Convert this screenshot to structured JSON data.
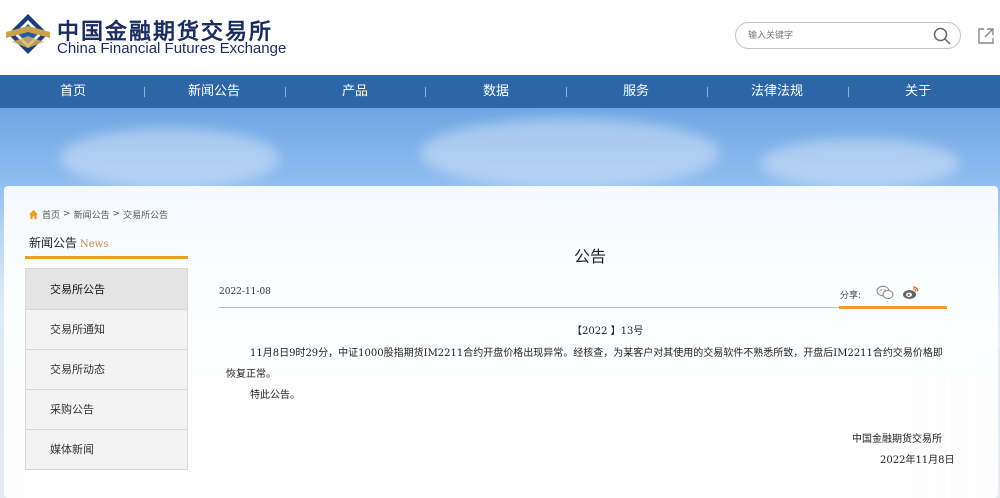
{
  "header": {
    "logo_cn": "中国金融期货交易所",
    "logo_en": "China Financial Futures Exchange",
    "search_placeholder": "输入关键字"
  },
  "nav": {
    "items": [
      "首页",
      "新闻公告",
      "产品",
      "数据",
      "服务",
      "法律法规",
      "关于"
    ]
  },
  "breadcrumb": {
    "home": "首页",
    "sep1": ">",
    "level1": "新闻公告",
    "sep2": ">",
    "level2": "交易所公告"
  },
  "sidebar": {
    "title": "新闻公告",
    "title_en": "News",
    "items": [
      "交易所公告",
      "交易所通知",
      "交易所动态",
      "采购公告",
      "媒体新闻"
    ]
  },
  "article": {
    "title": "公告",
    "date": "2022-11-08",
    "share_label": "分享:",
    "doc_no": "【2022 】13号",
    "body": "11月8日9时29分，中证1000股指期货IM2211合约开盘价格出现异常。经核查，为某客户对其使用的交易软件不熟悉所致，开盘后IM2211合约交易价格即恢复正常。",
    "closing": "特此公告。",
    "sign_org": "中国金融期货交易所",
    "sign_date": "2022年11月8日"
  },
  "colors": {
    "nav_bg": "#2d66a7",
    "accent": "#f39c2d",
    "brand_navy": "#1b2c5e"
  }
}
